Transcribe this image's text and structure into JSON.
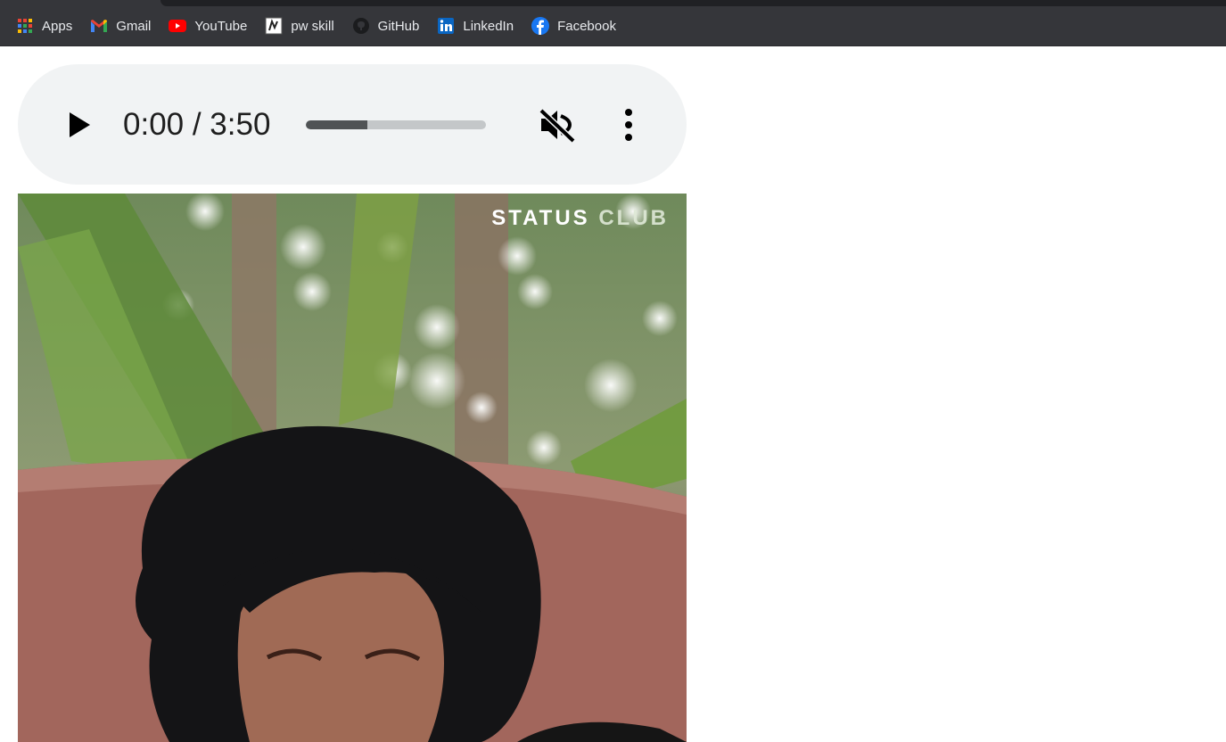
{
  "bookmarks": {
    "items": [
      {
        "label": "Apps",
        "icon": "apps-grid-icon"
      },
      {
        "label": "Gmail",
        "icon": "gmail-icon"
      },
      {
        "label": "YouTube",
        "icon": "youtube-icon"
      },
      {
        "label": "pw skill",
        "icon": "pw-skill-icon"
      },
      {
        "label": "GitHub",
        "icon": "github-icon"
      },
      {
        "label": "LinkedIn",
        "icon": "linkedin-icon"
      },
      {
        "label": "Facebook",
        "icon": "facebook-icon"
      }
    ]
  },
  "audio_player": {
    "time_display": "0:00 / 3:50",
    "buffered_fraction": 0.34,
    "muted": true,
    "icons": {
      "play": "play-icon",
      "mute": "volume-muted-icon",
      "more": "more-vert-icon"
    }
  },
  "video": {
    "watermark_part1": "STATUS",
    "watermark_part2": "CLUB"
  },
  "colors": {
    "bookmark_bar_bg": "#35363a",
    "bookmark_text": "#e8eaed",
    "player_bg": "#f1f3f4",
    "seek_fill": "#505355",
    "seek_track": "#c4c7c9"
  }
}
